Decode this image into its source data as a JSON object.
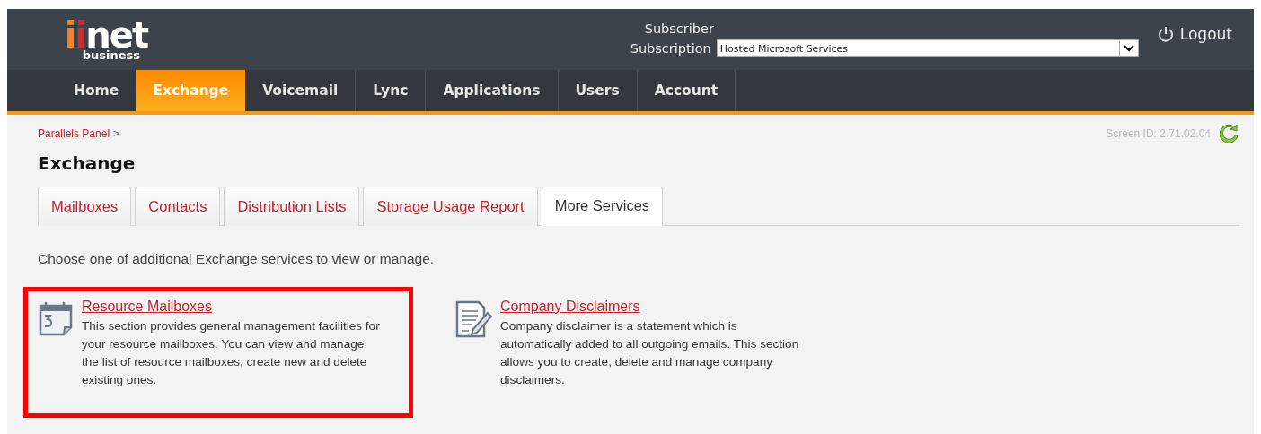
{
  "header": {
    "logo": {
      "name": "iinet",
      "sub": "business"
    },
    "subscriber_label": "Subscriber",
    "subscription_label": "Subscription",
    "subscription": {
      "value": "Hosted Microsoft Services"
    },
    "logout": "Logout"
  },
  "nav": [
    {
      "label": "Home",
      "selected": false
    },
    {
      "label": "Exchange",
      "selected": true
    },
    {
      "label": "Voicemail",
      "selected": false
    },
    {
      "label": "Lync",
      "selected": false
    },
    {
      "label": "Applications",
      "selected": false
    },
    {
      "label": "Users",
      "selected": false
    },
    {
      "label": "Account",
      "selected": false
    }
  ],
  "breadcrumb": [
    {
      "label": "Parallels Panel",
      "separator": ">"
    }
  ],
  "screen_id": "Screen ID: 2.71.02.04",
  "title": "Exchange",
  "tabs": [
    {
      "label": "Mailboxes",
      "selected": false
    },
    {
      "label": "Contacts",
      "selected": false
    },
    {
      "label": "Distribution Lists",
      "selected": false
    },
    {
      "label": "Storage Usage Report",
      "selected": false
    },
    {
      "label": "More Services",
      "selected": true
    }
  ],
  "intro": "Choose one of additional Exchange services to view or manage.",
  "services": [
    {
      "kind": "calendar",
      "title": "Resource Mailboxes",
      "description": "This section provides general management facilities for your resource mailboxes. You can view and manage the list of resource mailboxes, create new and delete existing ones.",
      "highlighted": true
    },
    {
      "kind": "document",
      "title": "Company Disclaimers",
      "description": "Company disclaimer is a statement which is automatically added to all outgoing emails. This section allows you to create, delete and manage company disclaimers.",
      "highlighted": false
    }
  ]
}
